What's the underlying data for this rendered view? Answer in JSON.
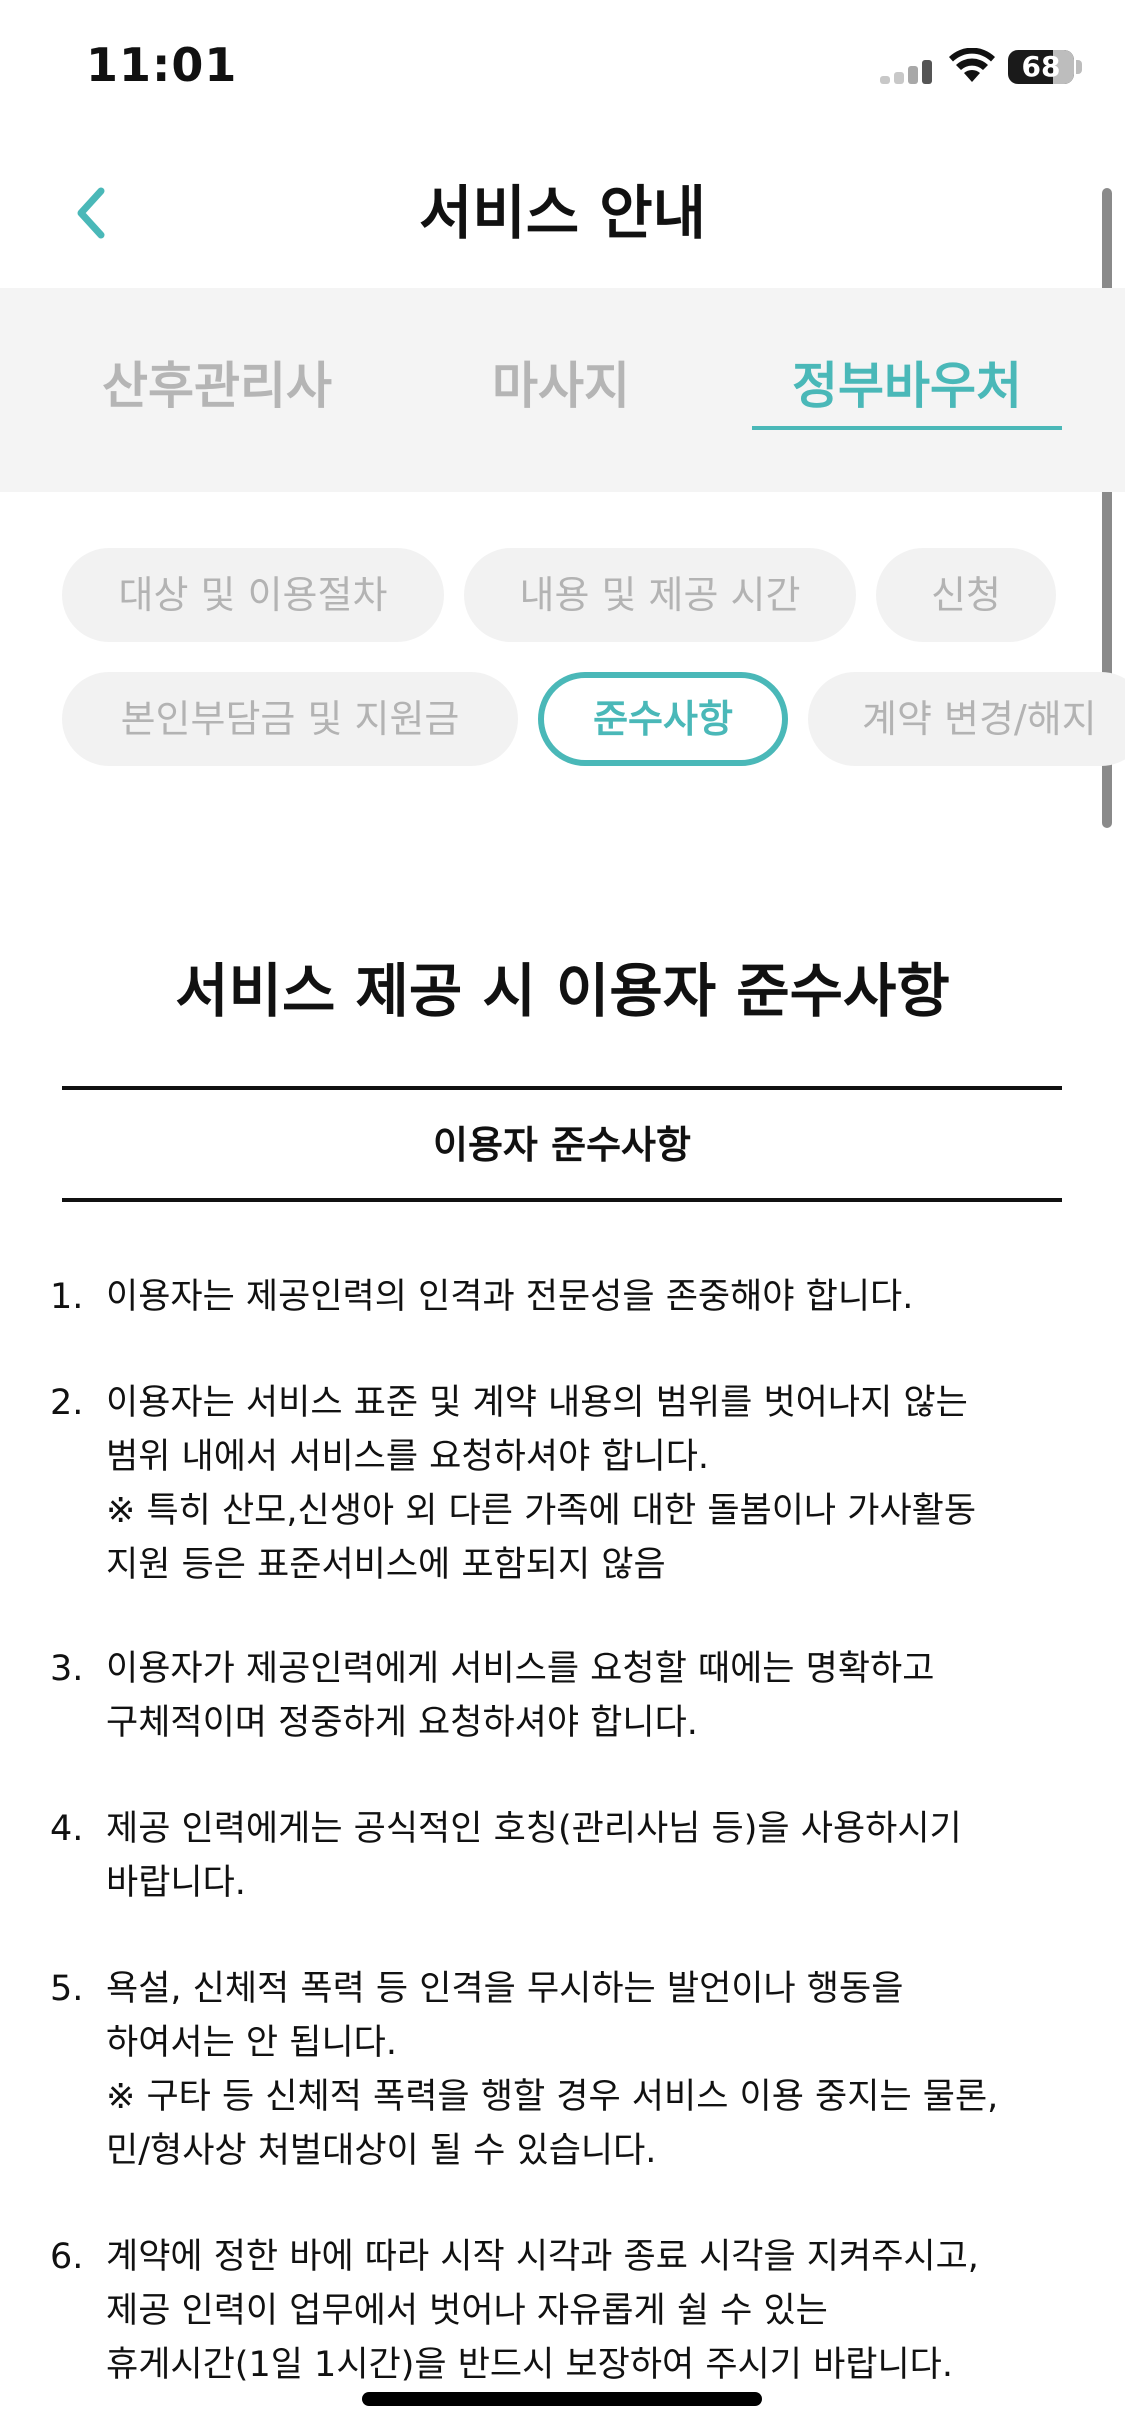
{
  "status_bar": {
    "time": "11:01",
    "battery_level": "68",
    "battery_percent": 68
  },
  "header": {
    "title": "서비스 안내",
    "back_icon": "chevron-left-icon"
  },
  "main_tabs": [
    {
      "label": "산후관리사",
      "active": false
    },
    {
      "label": "마사지",
      "active": false
    },
    {
      "label": "정부바우처",
      "active": true
    }
  ],
  "sub_tabs": [
    {
      "label": "대상 및 이용절차",
      "active": false
    },
    {
      "label": "내용 및 제공 시간",
      "active": false
    },
    {
      "label": "신청",
      "active": false
    },
    {
      "label": "본인부담금 및 지원금",
      "active": false
    },
    {
      "label": "준수사항",
      "active": true
    },
    {
      "label": "계약 변경/해지",
      "active": false
    }
  ],
  "content": {
    "section_title": "서비스 제공 시 이용자 준수사항",
    "table_header": "이용자 준수사항",
    "rules": [
      {
        "num": "1.",
        "lines": [
          "이용자는 제공인력의 인격과 전문성을 존중해야 합니다."
        ]
      },
      {
        "num": "2.",
        "lines": [
          "이용자는 서비스 표준 및 계약 내용의 범위를 벗어나지 않는",
          "범위 내에서 서비스를 요청하셔야 합니다.",
          "※ 특히 산모,신생아 외 다른 가족에 대한 돌봄이나 가사활동",
          "지원 등은 표준서비스에 포함되지 않음"
        ]
      },
      {
        "num": "3.",
        "lines": [
          "이용자가 제공인력에게 서비스를 요청할 때에는 명확하고",
          "구체적이며 정중하게 요청하셔야 합니다."
        ]
      },
      {
        "num": "4.",
        "lines": [
          "제공 인력에게는 공식적인 호칭(관리사님 등)을 사용하시기",
          "바랍니다."
        ]
      },
      {
        "num": "5.",
        "lines": [
          "욕설, 신체적 폭력 등 인격을 무시하는 발언이나 행동을",
          "하여서는 안 됩니다.",
          "※ 구타 등 신체적 폭력을 행할 경우 서비스 이용 중지는 물론,",
          "민/형사상 처벌대상이 될 수 있습니다."
        ]
      },
      {
        "num": "6.",
        "lines": [
          "계약에 정한 바에 따라 시작 시각과 종료 시각을 지켜주시고,",
          "제공 인력이 업무에서 벗어나 자유롭게 쉴 수 있는",
          "휴게시간(1일 1시간)을 반드시 보장하여 주시기 바랍니다."
        ]
      }
    ]
  },
  "colors": {
    "accent": "#4ab8b8",
    "inactive_text": "#b5b5b5",
    "tab_bg": "#f4f4f4",
    "chip_bg": "#f2f2f2"
  }
}
